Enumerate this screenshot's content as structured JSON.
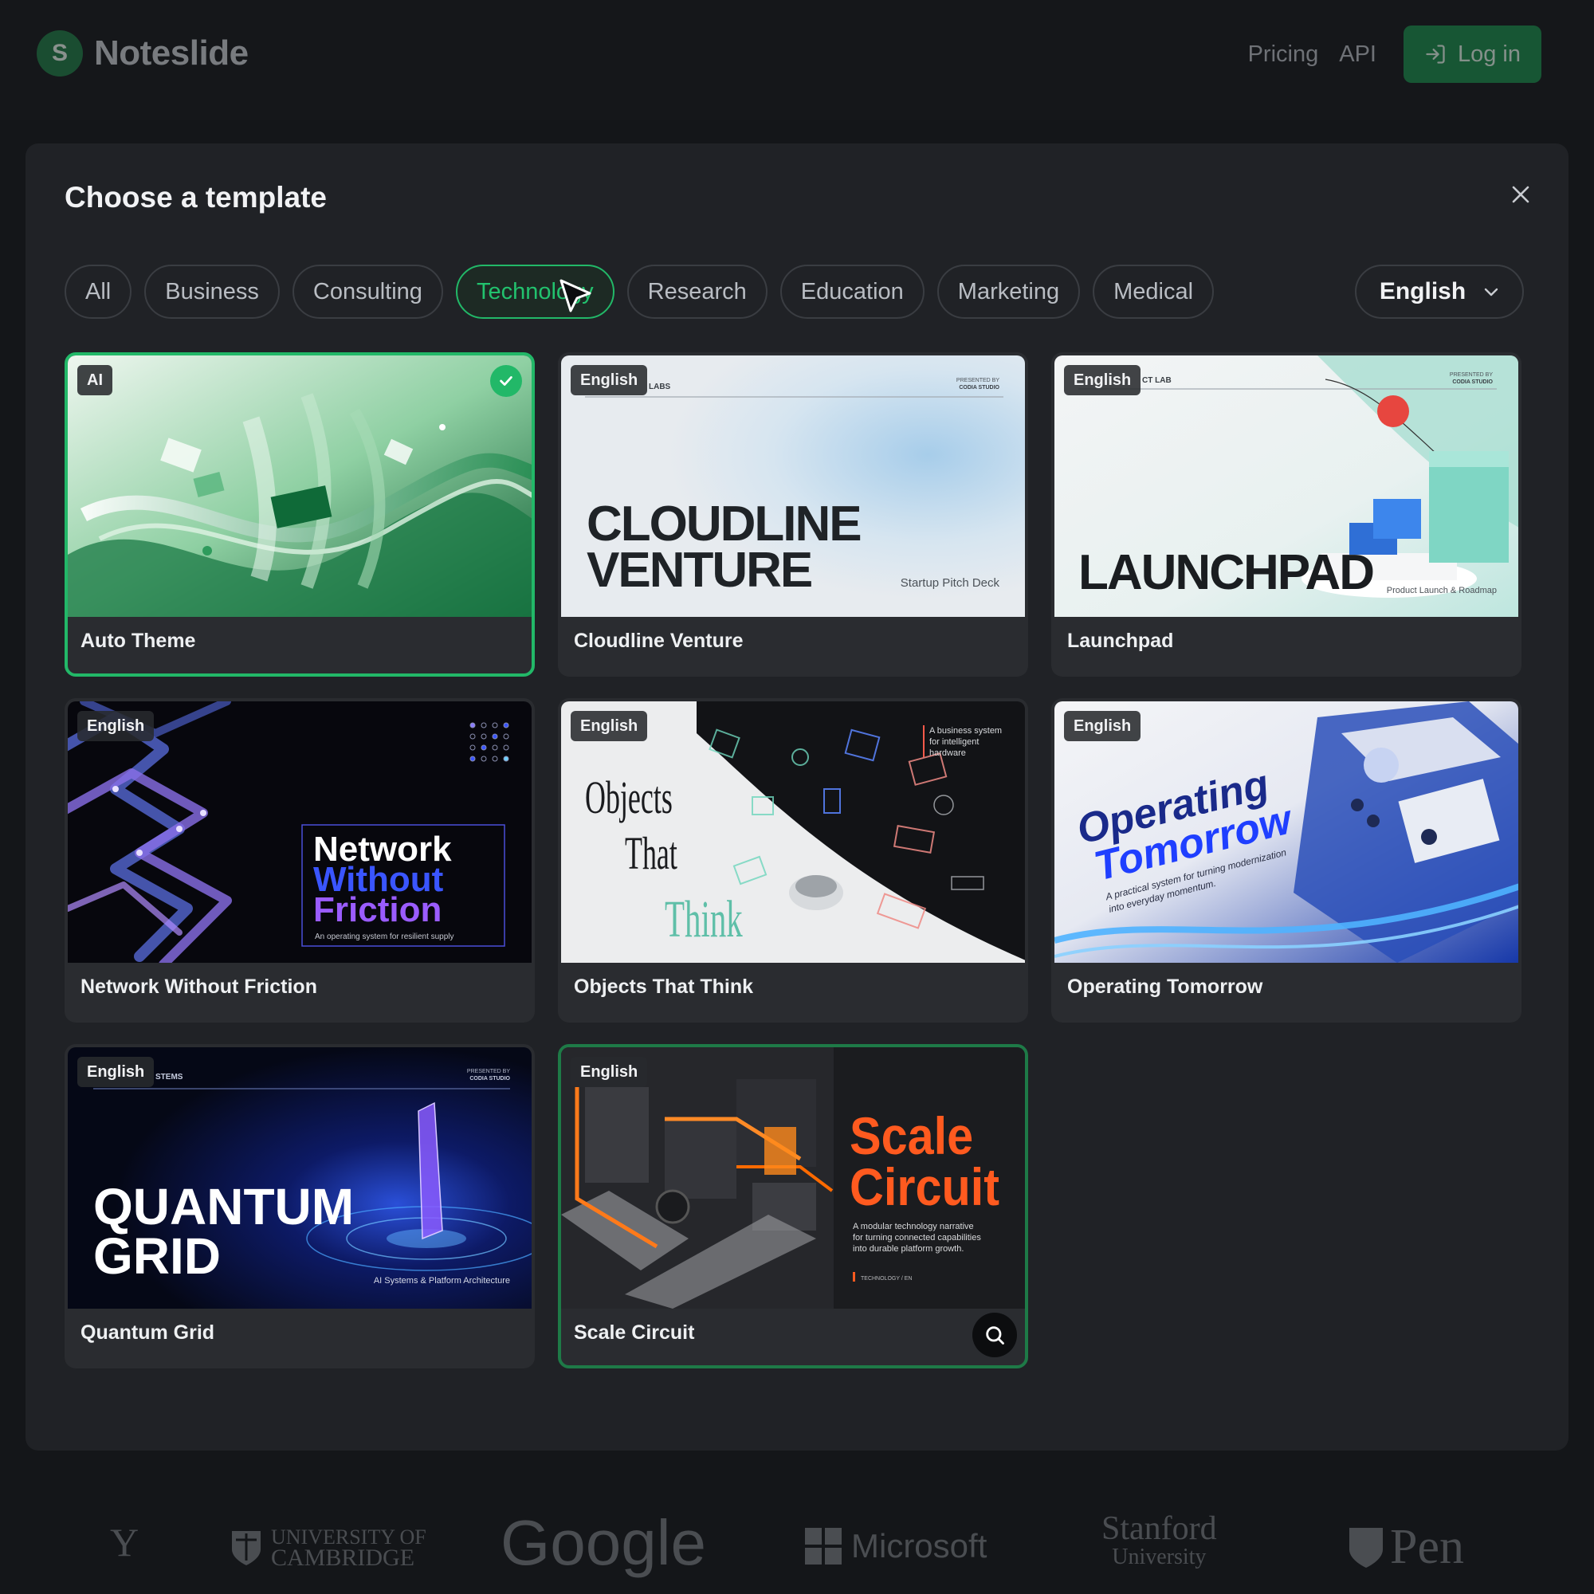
{
  "nav": {
    "brand": "Noteslide",
    "brand_mark": "S",
    "links": [
      "Pricing",
      "API"
    ],
    "login_label": "Log in"
  },
  "modal": {
    "title": "Choose a template",
    "filters": [
      "All",
      "Business",
      "Consulting",
      "Technology",
      "Research",
      "Education",
      "Marketing",
      "Medical"
    ],
    "active_filter": "Technology",
    "language": "English"
  },
  "templates": [
    {
      "name": "Auto Theme",
      "badge": "AI",
      "selected": true
    },
    {
      "name": "Cloudline Venture",
      "badge": "English",
      "thumb": {
        "line1": "CLOUDLINE",
        "line2": "VENTURE",
        "sub": "Startup Pitch Deck",
        "brand": "LABS",
        "presenter1": "PRESENTED BY",
        "presenter2": "CODIA STUDIO"
      }
    },
    {
      "name": "Launchpad",
      "badge": "English",
      "thumb": {
        "title": "LAUNCHPAD",
        "sub": "Product Launch & Roadmap",
        "brand": "CT LAB",
        "presenter1": "PRESENTED BY",
        "presenter2": "CODIA STUDIO"
      }
    },
    {
      "name": "Network Without Friction",
      "badge": "English",
      "thumb": {
        "line1": "Network",
        "line2": "Without",
        "line3": "Friction",
        "sub": "An operating system for resilient supply"
      }
    },
    {
      "name": "Objects That Think",
      "badge": "English",
      "thumb": {
        "word1": "Objects",
        "word2": "That",
        "word3": "Think",
        "side1": "A business system",
        "side2": "for intelligent",
        "side3": "hardware"
      }
    },
    {
      "name": "Operating Tomorrow",
      "badge": "English",
      "thumb": {
        "line1": "Operating",
        "line2": "Tomorrow",
        "sub1": "A practical system for turning modernization",
        "sub2": "into everyday momentum."
      }
    },
    {
      "name": "Quantum Grid",
      "badge": "English",
      "thumb": {
        "line1": "QUANTUM",
        "line2": "GRID",
        "sub": "AI Systems & Platform Architecture",
        "brand": "STEMS",
        "presenter1": "PRESENTED BY",
        "presenter2": "CODIA STUDIO"
      }
    },
    {
      "name": "Scale Circuit",
      "badge": "English",
      "hovered": true,
      "thumb": {
        "line1": "Scale",
        "line2": "Circuit",
        "sub1": "A modular technology narrative",
        "sub2": "for turning connected capabilities",
        "sub3": "into durable platform growth.",
        "tag": "TECHNOLOGY / EN"
      }
    }
  ],
  "partner_logos": [
    "Y",
    "UNIVERSITY OF",
    "CAMBRIDGE",
    "Google",
    "Microsoft",
    "Stanford",
    "University",
    "Pen"
  ],
  "colors": {
    "accent": "#22b868",
    "background": "#141619",
    "modal": "#202226"
  }
}
